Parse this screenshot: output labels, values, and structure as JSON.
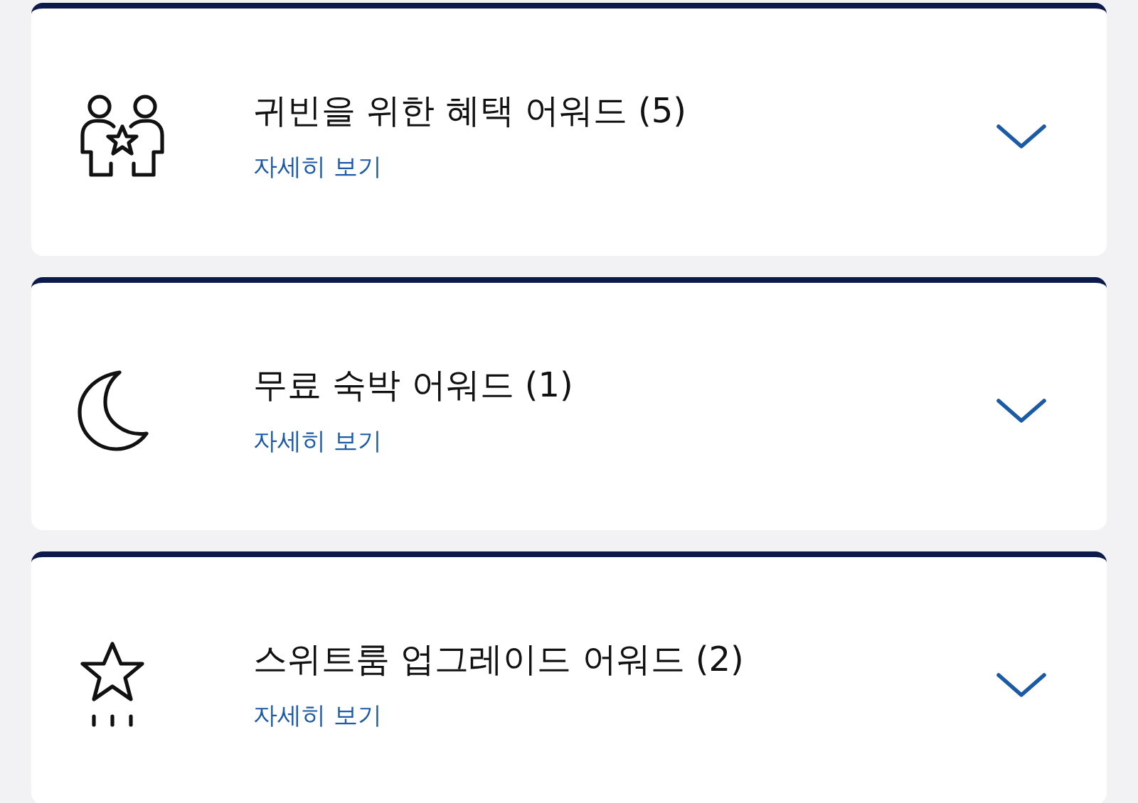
{
  "awards": [
    {
      "kind": "guests",
      "title": "귀빈을 위한 혜택 어워드 (5)",
      "link": "자세히 보기",
      "expanded": false
    },
    {
      "kind": "moon",
      "title": "무료 숙박 어워드 (1)",
      "link": "자세히 보기",
      "expanded": false
    },
    {
      "kind": "star",
      "title": "스위트룸 업그레이드 어워드 (2)",
      "link": "자세히 보기",
      "expanded": false
    }
  ]
}
